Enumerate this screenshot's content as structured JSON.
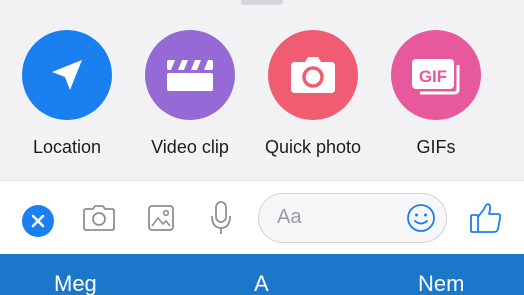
{
  "actions": [
    {
      "label": "Location",
      "icon": "location-arrow-icon",
      "color": "#1a80f0"
    },
    {
      "label": "Video clip",
      "icon": "clapperboard-icon",
      "color": "#9569d6"
    },
    {
      "label": "Quick photo",
      "icon": "camera-icon",
      "color": "#f05d72"
    },
    {
      "label": "GIFs",
      "icon": "gif-icon",
      "color": "#e8589c",
      "icon_text": "GIF"
    }
  ],
  "composer": {
    "close_icon": "close-icon",
    "input_placeholder": "Aa",
    "accent": "#1a80f0",
    "icons": [
      "camera-icon",
      "image-icon",
      "microphone-icon",
      "emoji-icon",
      "thumbs-up-icon"
    ]
  },
  "suggestions": [
    "Meg",
    "A",
    "Nem"
  ],
  "colors": {
    "suggestion_bar": "#1a77c9",
    "tray": "#f2f2f5"
  }
}
